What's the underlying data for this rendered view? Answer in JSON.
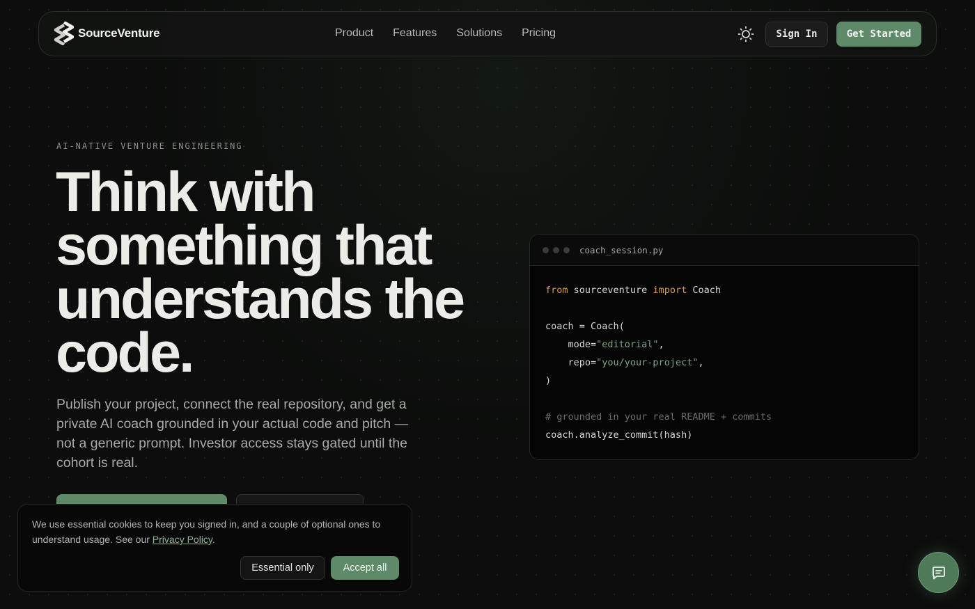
{
  "nav": {
    "brand": "SourceVenture",
    "links": [
      {
        "label": "Product"
      },
      {
        "label": "Features"
      },
      {
        "label": "Solutions"
      },
      {
        "label": "Pricing"
      }
    ],
    "theme_icon": "sun-icon",
    "sign_in": "Sign In",
    "get_started": "Get Started"
  },
  "hero": {
    "eyebrow": "AI-NATIVE VENTURE ENGINEERING",
    "headline": "Think with something that understands the code.",
    "subcopy": "Publish your project, connect the real repository, and get a private AI coach grounded in your actual code and pitch — not a generic prompt. Investor access stays gated until the cohort is real."
  },
  "code_card": {
    "filename": "coach_session.py",
    "lines": {
      "l1_kw1": "from",
      "l1_mod": " sourceventure ",
      "l1_kw2": "import",
      "l1_cls": " Coach",
      "l3": "coach = Coach(",
      "l4_key": "    mode=",
      "l4_val": "\"editorial\"",
      "l4_end": ",",
      "l5_key": "    repo=",
      "l5_val": "\"you/your-project\"",
      "l5_end": ",",
      "l6": ")",
      "l8": "# grounded in your real README + commits",
      "l9": "coach.analyze_commit(hash)"
    }
  },
  "cookie": {
    "text": "We use essential cookies to keep you signed in, and a couple of optional ones to understand usage. See our ",
    "link": "Privacy Policy",
    "end": ".",
    "essential": "Essential only",
    "accept": "Accept all"
  },
  "chat": {
    "icon": "chat-bubble-icon"
  },
  "colors": {
    "accent": "#5f8a69",
    "background": "#0c0d0c",
    "keyword": "#d89a4a",
    "string": "#7fa586"
  }
}
